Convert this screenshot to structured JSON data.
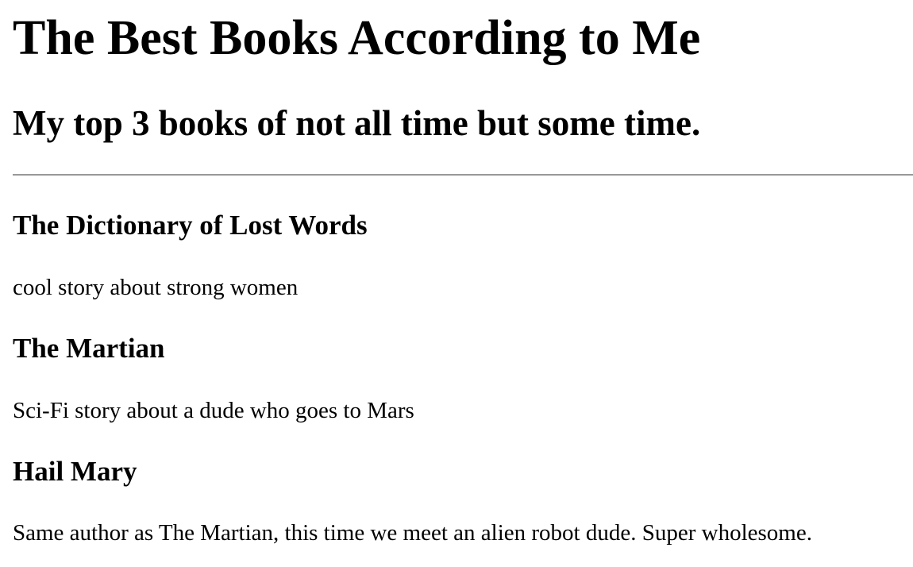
{
  "page": {
    "title": "The Best Books According to Me",
    "subtitle": "My top 3 books of not all time but some time."
  },
  "books": [
    {
      "title": "The Dictionary of Lost Words",
      "description": "cool story about strong women"
    },
    {
      "title": "The Martian",
      "description": "Sci-Fi story about a dude who goes to Mars"
    },
    {
      "title": "Hail Mary",
      "description": "Same author as The Martian, this time we meet an alien robot dude. Super wholesome."
    }
  ]
}
